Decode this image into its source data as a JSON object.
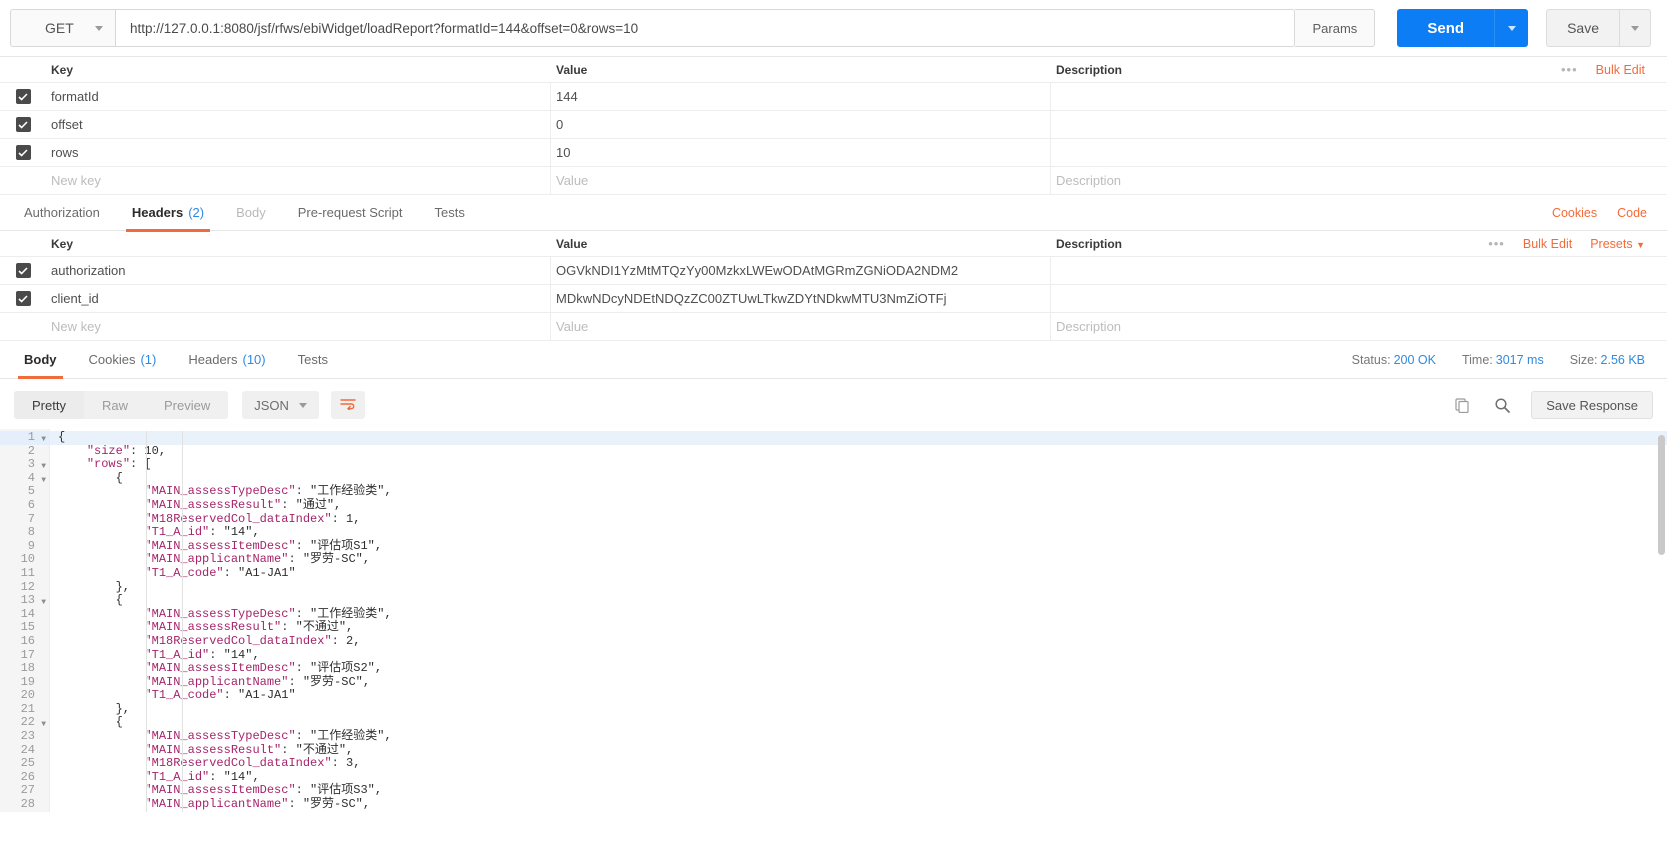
{
  "request": {
    "method": "GET",
    "url": "http://127.0.0.1:8080/jsf/rfws/ebiWidget/loadReport?formatId=144&offset=0&rows=10",
    "params_button": "Params",
    "send_button": "Send",
    "save_button": "Save"
  },
  "params_table": {
    "columns": {
      "key": "Key",
      "value": "Value",
      "description": "Description"
    },
    "bulk_edit": "Bulk Edit",
    "rows": [
      {
        "checked": true,
        "key": "formatId",
        "value": "144",
        "description": ""
      },
      {
        "checked": true,
        "key": "offset",
        "value": "0",
        "description": ""
      },
      {
        "checked": true,
        "key": "rows",
        "value": "10",
        "description": ""
      }
    ],
    "new_row": {
      "key": "New key",
      "value": "Value",
      "description": "Description"
    }
  },
  "request_tabs": {
    "items": [
      {
        "label": "Authorization",
        "count": "",
        "state": "inactive"
      },
      {
        "label": "Headers",
        "count": "(2)",
        "state": "active"
      },
      {
        "label": "Body",
        "count": "",
        "state": "muted"
      },
      {
        "label": "Pre-request Script",
        "count": "",
        "state": "inactive"
      },
      {
        "label": "Tests",
        "count": "",
        "state": "inactive"
      }
    ],
    "cookies_link": "Cookies",
    "code_link": "Code"
  },
  "headers_table": {
    "columns": {
      "key": "Key",
      "value": "Value",
      "description": "Description"
    },
    "bulk_edit": "Bulk Edit",
    "presets": "Presets",
    "rows": [
      {
        "checked": true,
        "key": "authorization",
        "value": "OGVkNDI1YzMtMTQzYy00MzkxLWEwODAtMGRmZGNiODA2NDM2",
        "description": ""
      },
      {
        "checked": true,
        "key": "client_id",
        "value": "MDkwNDcyNDEtNDQzZC00ZTUwLTkwZDYtNDkwMTU3NmZiOTFj",
        "description": ""
      }
    ],
    "new_row": {
      "key": "New key",
      "value": "Value",
      "description": "Description"
    }
  },
  "response": {
    "tabs": [
      {
        "label": "Body",
        "count": "",
        "state": "active"
      },
      {
        "label": "Cookies",
        "count": "(1)",
        "state": "inactive"
      },
      {
        "label": "Headers",
        "count": "(10)",
        "state": "inactive"
      },
      {
        "label": "Tests",
        "count": "",
        "state": "inactive"
      }
    ],
    "status_label": "Status:",
    "status_value": "200 OK",
    "time_label": "Time:",
    "time_value": "3017 ms",
    "size_label": "Size:",
    "size_value": "2.56 KB",
    "view_modes": [
      {
        "label": "Pretty",
        "active": true
      },
      {
        "label": "Raw",
        "active": false
      },
      {
        "label": "Preview",
        "active": false
      }
    ],
    "format": "JSON",
    "save_response": "Save Response",
    "body_lines": [
      {
        "n": "1",
        "fold": true,
        "text": "{"
      },
      {
        "n": "2",
        "fold": false,
        "text": "    \"size\": 10,"
      },
      {
        "n": "3",
        "fold": true,
        "text": "    \"rows\": ["
      },
      {
        "n": "4",
        "fold": true,
        "text": "        {"
      },
      {
        "n": "5",
        "fold": false,
        "text": "            \"MAIN_assessTypeDesc\": \"工作经验类\","
      },
      {
        "n": "6",
        "fold": false,
        "text": "            \"MAIN_assessResult\": \"通过\","
      },
      {
        "n": "7",
        "fold": false,
        "text": "            \"M18ReservedCol_dataIndex\": 1,"
      },
      {
        "n": "8",
        "fold": false,
        "text": "            \"T1_A_id\": \"14\","
      },
      {
        "n": "9",
        "fold": false,
        "text": "            \"MAIN_assessItemDesc\": \"评估项S1\","
      },
      {
        "n": "10",
        "fold": false,
        "text": "            \"MAIN_applicantName\": \"罗劳-SC\","
      },
      {
        "n": "11",
        "fold": false,
        "text": "            \"T1_A_code\": \"A1-JA1\""
      },
      {
        "n": "12",
        "fold": false,
        "text": "        },"
      },
      {
        "n": "13",
        "fold": true,
        "text": "        {"
      },
      {
        "n": "14",
        "fold": false,
        "text": "            \"MAIN_assessTypeDesc\": \"工作经验类\","
      },
      {
        "n": "15",
        "fold": false,
        "text": "            \"MAIN_assessResult\": \"不通过\","
      },
      {
        "n": "16",
        "fold": false,
        "text": "            \"M18ReservedCol_dataIndex\": 2,"
      },
      {
        "n": "17",
        "fold": false,
        "text": "            \"T1_A_id\": \"14\","
      },
      {
        "n": "18",
        "fold": false,
        "text": "            \"MAIN_assessItemDesc\": \"评估项S2\","
      },
      {
        "n": "19",
        "fold": false,
        "text": "            \"MAIN_applicantName\": \"罗劳-SC\","
      },
      {
        "n": "20",
        "fold": false,
        "text": "            \"T1_A_code\": \"A1-JA1\""
      },
      {
        "n": "21",
        "fold": false,
        "text": "        },"
      },
      {
        "n": "22",
        "fold": true,
        "text": "        {"
      },
      {
        "n": "23",
        "fold": false,
        "text": "            \"MAIN_assessTypeDesc\": \"工作经验类\","
      },
      {
        "n": "24",
        "fold": false,
        "text": "            \"MAIN_assessResult\": \"不通过\","
      },
      {
        "n": "25",
        "fold": false,
        "text": "            \"M18ReservedCol_dataIndex\": 3,"
      },
      {
        "n": "26",
        "fold": false,
        "text": "            \"T1_A_id\": \"14\","
      },
      {
        "n": "27",
        "fold": false,
        "text": "            \"MAIN_assessItemDesc\": \"评估项S3\","
      },
      {
        "n": "28",
        "fold": false,
        "text": "            \"MAIN_applicantName\": \"罗劳-SC\","
      }
    ]
  },
  "colors": {
    "accent_orange": "#f26b3a",
    "send_blue": "#0d7df5",
    "link_blue": "#2f8ae0",
    "json_key": "#a6246b",
    "json_string": "#2b44c7"
  }
}
